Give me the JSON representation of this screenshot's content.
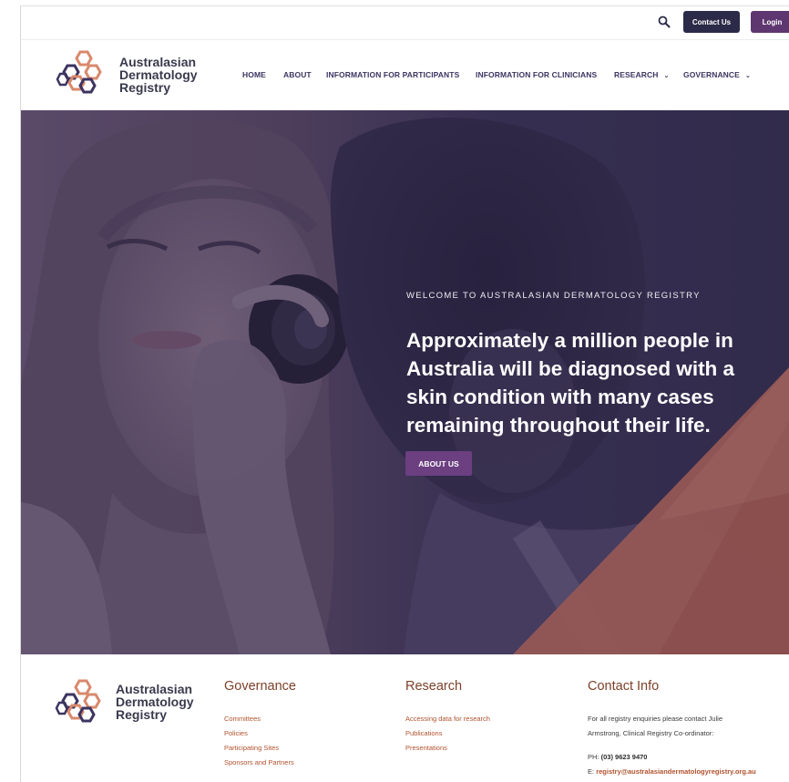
{
  "topbar": {
    "search_icon": "search-icon",
    "contact_label": "Contact Us",
    "login_label": "Login"
  },
  "header": {
    "logo": {
      "line1": "Australasian",
      "line2": "Dermatology",
      "line3": "Registry"
    },
    "nav": [
      {
        "label": "HOME"
      },
      {
        "label": "ABOUT"
      },
      {
        "label": "INFORMATION FOR PARTICIPANTS"
      },
      {
        "label": "INFORMATION FOR CLINICIANS"
      },
      {
        "label": "RESEARCH",
        "has_dropdown": true
      },
      {
        "label": "GOVERNANCE",
        "has_dropdown": true
      }
    ]
  },
  "hero": {
    "eyebrow": "WELCOME TO AUSTRALASIAN DERMATOLOGY REGISTRY",
    "title": "Approximately a million people in Australia will be diagnosed with a skin condition with many cases remaining throughout their life.",
    "button_label": "ABOUT US"
  },
  "footer": {
    "logo": {
      "line1": "Australasian",
      "line2": "Dermatology",
      "line3": "Registry"
    },
    "governance": {
      "heading": "Governance",
      "links": [
        "Committees",
        "Policies",
        "Participating Sites",
        "Sponsors and Partners"
      ]
    },
    "research": {
      "heading": "Research",
      "links": [
        "Accessing data for research",
        "Publications",
        "Presentations"
      ]
    },
    "contact": {
      "heading": "Contact Info",
      "intro_line1": "For all registry enquiries please contact Julie",
      "intro_line2": "Armstrong, Clinical Registry Co-ordinator:",
      "phone_label": "PH:",
      "phone": "(03) 9623 9470",
      "email_label": "E:",
      "email": "registry@australasiandermatologyregistry.org.au"
    }
  },
  "colors": {
    "navy_button": "#2b2a48",
    "login_purple": "#5f3770",
    "hero_overlay": "#3f3357",
    "hero_button": "#6b3f80",
    "accent_orange": "#d07a5c",
    "footer_heading": "#7c4028",
    "footer_link": "#b0522e"
  }
}
